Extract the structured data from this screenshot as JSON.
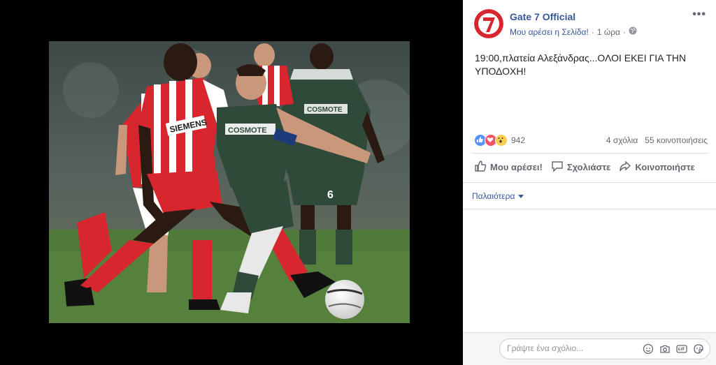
{
  "post": {
    "page_name": "Gate 7 Official",
    "like_page": "Μου αρέσει η Σελίδα!",
    "separator": "·",
    "time": "1 ώρα",
    "more": "•••",
    "text": "19:00,πλατεία Αλεξάνδρας...ΟΛΟΙ ΕΚΕΙ ΓΙΑ ΤΗΝ ΥΠΟΔΟΧΗ!"
  },
  "stats": {
    "reaction_icons": [
      "like-icon",
      "love-icon",
      "wow-icon"
    ],
    "reactions_count": "942",
    "comments": "4 σχόλια",
    "shares": "55 κοινοποιήσεις"
  },
  "actions": {
    "like": "Μου αρέσει!",
    "comment": "Σχολιάστε",
    "share": "Κοινοποιήστε"
  },
  "comments": {
    "older": "Παλαιότερα",
    "placeholder": "Γράψτε ένα σχόλιο...",
    "composer_icons": [
      "emoji-icon",
      "camera-icon",
      "gif-icon",
      "sticker-icon"
    ]
  },
  "photo": {
    "sponsor_left": "SIEMENS",
    "sponsor_right": "COSMOTE",
    "shirt_number": "6"
  },
  "colors": {
    "link": "#385898",
    "photo_bg": "#000000",
    "olympiacos_red": "#d8262f",
    "panathinaikos_green": "#2f4a38",
    "pitch": "#4f7a3a"
  }
}
